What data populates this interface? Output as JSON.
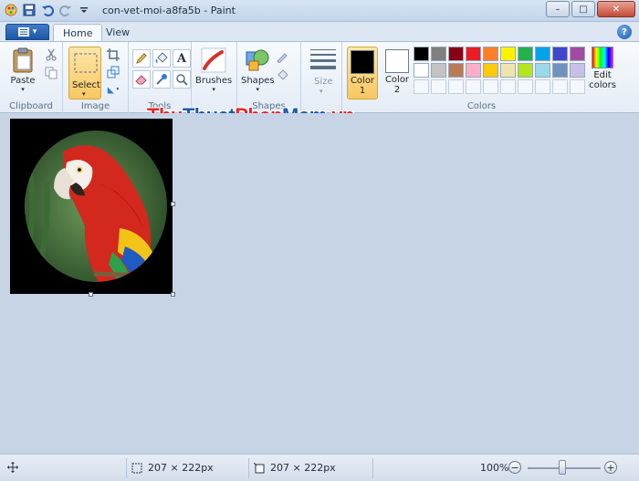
{
  "window": {
    "title": "con-vet-moi-a8fa5b - Paint",
    "minimize": "–",
    "maximize": "□",
    "close": "✕"
  },
  "tabs": {
    "home": "Home",
    "view": "View"
  },
  "help_label": "?",
  "ribbon": {
    "clipboard": {
      "label": "Clipboard",
      "paste": "Paste"
    },
    "image": {
      "label": "Image",
      "select": "Select"
    },
    "tools": {
      "label": "Tools"
    },
    "brushes": "Brushes",
    "shapes": {
      "button": "Shapes",
      "label": "Shapes"
    },
    "size": "Size",
    "colors": {
      "label": "Colors",
      "color1_line1": "Color",
      "color1_line2": "1",
      "color2_line1": "Color",
      "color2_line2": "2",
      "color1_value": "#000000",
      "color2_value": "#ffffff",
      "edit_line1": "Edit",
      "edit_line2": "colors",
      "palette": [
        "#000000",
        "#7f7f7f",
        "#880015",
        "#ed1c24",
        "#ff7f27",
        "#fff200",
        "#22b14c",
        "#00a2e8",
        "#3f48cc",
        "#a349a4",
        "#ffffff",
        "#c3c3c3",
        "#b97a57",
        "#ffaec9",
        "#ffc90e",
        "#efe4b0",
        "#b5e61d",
        "#99d9ea",
        "#7092be",
        "#c8bfe7"
      ],
      "empty_slots": 10
    }
  },
  "watermark": {
    "part1": "Thu",
    "part2": "Thuat",
    "part3": "Phan",
    "part4": "Mem",
    "part5": ".vn",
    "colors": [
      "#e8262b",
      "#1a5bb0",
      "#e8262b",
      "#1a5bb0",
      "#e8262b"
    ]
  },
  "status": {
    "selection_size": "207 × 222px",
    "image_size": "207 × 222px",
    "zoom": "100%",
    "zoom_out": "−",
    "zoom_in": "+"
  }
}
